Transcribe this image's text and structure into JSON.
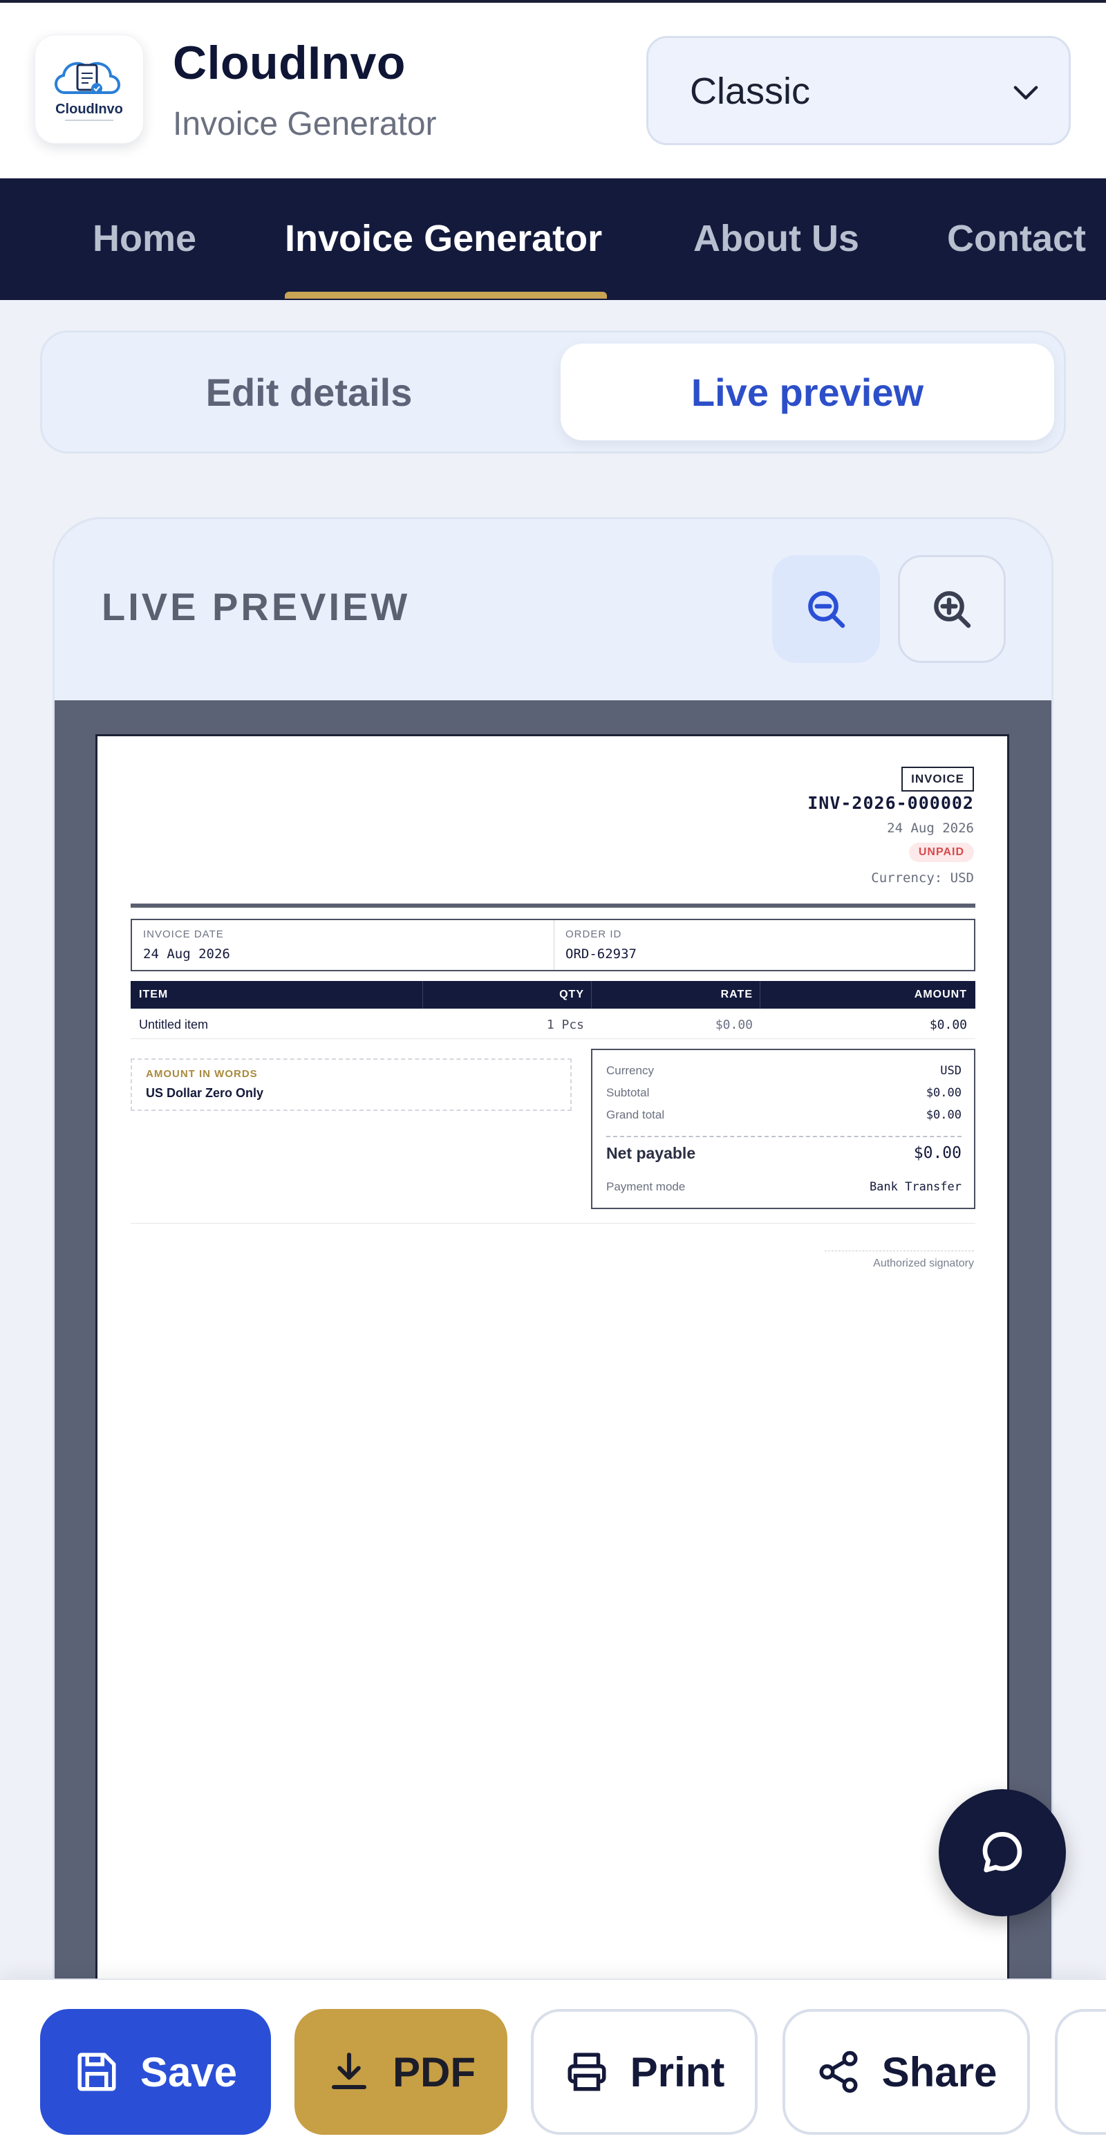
{
  "header": {
    "logo_text": "CloudInvo",
    "brand_title": "CloudInvo",
    "brand_subtitle": "Invoice Generator",
    "template_select": {
      "value": "Classic"
    }
  },
  "nav": {
    "items": [
      {
        "label": "Home"
      },
      {
        "label": "Invoice Generator",
        "active": true
      },
      {
        "label": "About Us"
      },
      {
        "label": "Contact"
      }
    ]
  },
  "segmented": {
    "edit_label": "Edit details",
    "live_label": "Live preview",
    "selected": "Live preview"
  },
  "preview": {
    "title": "LIVE PREVIEW",
    "zoom_out_icon": "zoom-out-icon",
    "zoom_in_icon": "zoom-in-icon"
  },
  "invoice": {
    "tag": "INVOICE",
    "number": "INV-2026-000002",
    "date": "24 Aug 2026",
    "status": "UNPAID",
    "currency_line": "Currency: USD",
    "meta": {
      "invoice_date_label": "INVOICE DATE",
      "invoice_date": "24 Aug 2026",
      "order_id_label": "ORDER ID",
      "order_id": "ORD-62937"
    },
    "table": {
      "headers": {
        "item": "ITEM",
        "qty": "QTY",
        "rate": "RATE",
        "amount": "AMOUNT"
      },
      "rows": [
        {
          "item": "Untitled item",
          "qty": "1 Pcs",
          "rate": "$0.00",
          "amount": "$0.00"
        }
      ]
    },
    "amount_in_words": {
      "label": "AMOUNT IN WORDS",
      "value": "US Dollar Zero Only"
    },
    "totals": {
      "currency_label": "Currency",
      "currency": "USD",
      "subtotal_label": "Subtotal",
      "subtotal": "$0.00",
      "grand_total_label": "Grand total",
      "grand_total": "$0.00",
      "net_payable_label": "Net payable",
      "net_payable": "$0.00",
      "payment_mode_label": "Payment mode",
      "payment_mode": "Bank Transfer"
    },
    "signature_label": "Authorized signatory"
  },
  "toolbar": {
    "save_label": "Save",
    "pdf_label": "PDF",
    "print_label": "Print",
    "share_label": "Share"
  },
  "colors": {
    "navy": "#131a3c",
    "accent_blue": "#2a4fd6",
    "gold": "#c79f45",
    "unpaid_red": "#d64a4a"
  }
}
